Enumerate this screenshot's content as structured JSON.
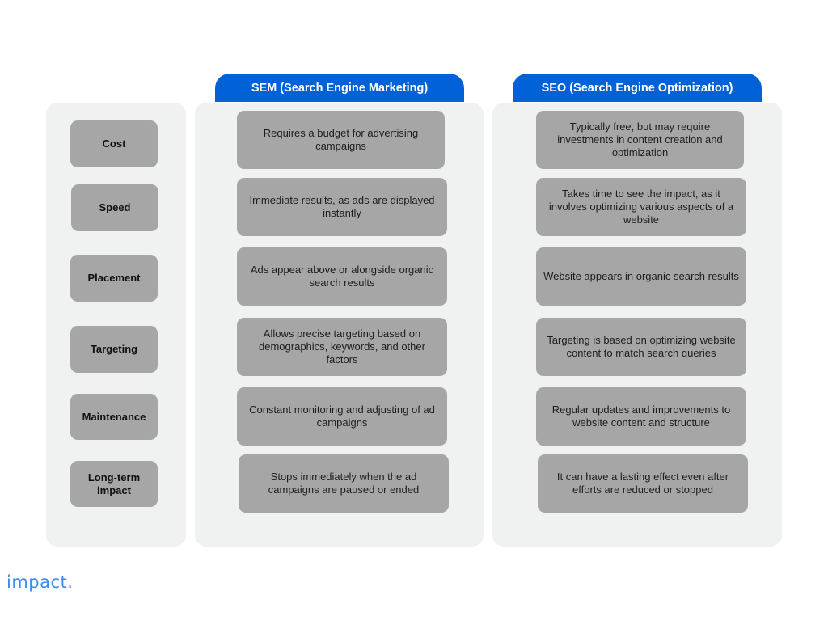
{
  "columns": {
    "sem_header": "SEM (Search Engine Marketing)",
    "seo_header": "SEO (Search Engine Optimization)"
  },
  "rows": [
    {
      "label": "Cost",
      "sem": "Requires a budget for advertising campaigns",
      "seo": "Typically free, but may require investments in content creation and optimization"
    },
    {
      "label": "Speed",
      "sem": "Immediate results, as ads are displayed instantly",
      "seo": "Takes time to see the impact, as it involves optimizing various aspects of a website"
    },
    {
      "label": "Placement",
      "sem": "Ads appear above or alongside organic search results",
      "seo": "Website appears in organic search results"
    },
    {
      "label": "Targeting",
      "sem": "Allows precise targeting based on demographics, keywords, and other factors",
      "seo": "Targeting is based on optimizing website content to match search queries"
    },
    {
      "label": "Maintenance",
      "sem": "Constant monitoring and adjusting of ad campaigns",
      "seo": "Regular updates and improvements to website content and structure"
    },
    {
      "label": "Long-term impact",
      "sem": "Stops immediately when the ad campaigns are paused or ended",
      "seo": "It can have a lasting effect even after efforts are reduced or stopped"
    }
  ],
  "brand": {
    "logo_text": "impact.",
    "accent_color": "#0062d6"
  }
}
